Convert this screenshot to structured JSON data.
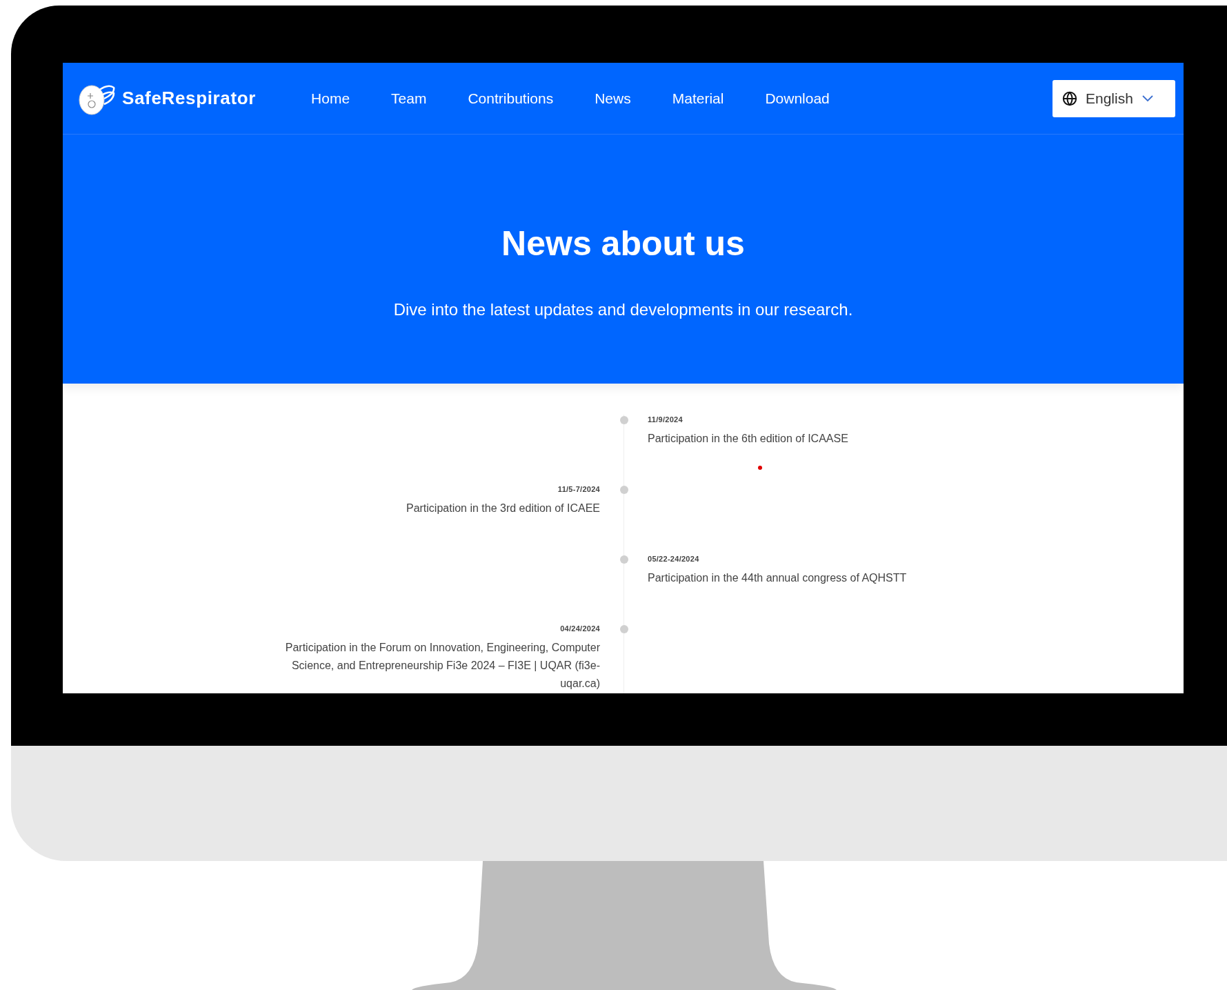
{
  "brand": "SafeRespirator",
  "nav": [
    {
      "label": "Home"
    },
    {
      "label": "Team"
    },
    {
      "label": "Contributions"
    },
    {
      "label": "News"
    },
    {
      "label": "Material"
    },
    {
      "label": "Download"
    }
  ],
  "language": {
    "value": "English"
  },
  "hero": {
    "title": "News about us",
    "subtitle": "Dive into the latest updates and developments in our research."
  },
  "timeline": [
    {
      "kind": "right",
      "date": "11/9/2024",
      "title": "Participation in the 6th edition of ICAASE"
    },
    {
      "kind": "left",
      "date": "11/5-7/2024",
      "title": "Participation in the 3rd edition of ICAEE"
    },
    {
      "kind": "right",
      "date": "05/22-24/2024",
      "title": "Participation in the 44th annual congress of AQHSTT"
    },
    {
      "kind": "left",
      "date": "04/24/2024",
      "title": "Participation in the Forum on Innovation, Engineering, Computer Science, and Entrepreneurship Fi3e 2024 – FI3E | UQAR (fi3e-uqar.ca)"
    }
  ]
}
